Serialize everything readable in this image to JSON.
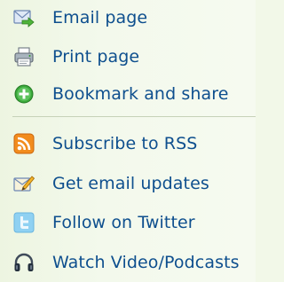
{
  "share_actions": [
    {
      "label": "Email page",
      "icon": "email-icon"
    },
    {
      "label": "Print page",
      "icon": "printer-icon"
    },
    {
      "label": "Bookmark and share",
      "icon": "bookmark-add-icon"
    }
  ],
  "follow_actions": [
    {
      "label": "Subscribe to RSS",
      "icon": "rss-icon"
    },
    {
      "label": "Get email updates",
      "icon": "email-updates-icon"
    },
    {
      "label": "Follow on Twitter",
      "icon": "twitter-icon"
    },
    {
      "label": "Watch Video/Podcasts",
      "icon": "headphones-icon"
    }
  ],
  "colors": {
    "link": "#0e4f8e",
    "background": "#f2f8e8",
    "divider": "#c6d2b8"
  }
}
